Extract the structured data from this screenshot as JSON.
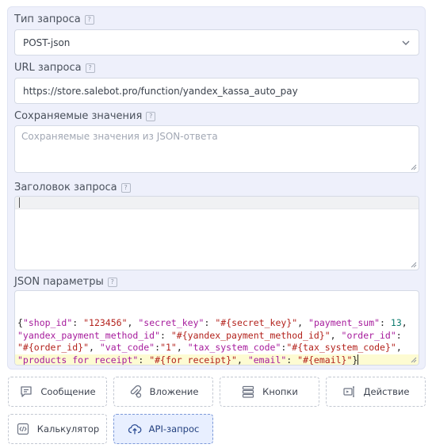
{
  "form": {
    "request_type": {
      "label": "Тип запроса",
      "help": "?",
      "value": "POST-json"
    },
    "url": {
      "label": "URL запроса",
      "help": "?",
      "value": "https://store.salebot.pro/function/yandex_kassa_auto_pay"
    },
    "saved_values": {
      "label": "Сохраняемые значения",
      "help": "?",
      "placeholder": "Сохраняемые значения из JSON-ответа"
    },
    "request_header": {
      "label": "Заголовок запроса",
      "help": "?",
      "value": ""
    },
    "json_params": {
      "label": "JSON параметры",
      "help": "?",
      "value": "{\"shop_id\": \"123456\", \"secret_key\": \"#{secret_key}\", \"payment_sum\": 13,\n\"yandex_payment_method_id\": \"#{yandex_payment_method_id}\", \"order_id\":\n\"#{order_id}\", \"vat_code\":\"1\", \"tax_system_code\":\"#{tax_system_code}\",\n\"products_for_receipt\": \"#{for_receipt}\", \"email\": \"#{email}\"}",
      "lines": [
        [
          {
            "t": "p",
            "v": "{"
          },
          {
            "t": "k",
            "v": "\"shop_id\""
          },
          {
            "t": "p",
            "v": ": "
          },
          {
            "t": "s",
            "v": "\"123456\""
          },
          {
            "t": "p",
            "v": ", "
          },
          {
            "t": "k",
            "v": "\"secret_key\""
          },
          {
            "t": "p",
            "v": ": "
          },
          {
            "t": "s",
            "v": "\"#{secret_key}\""
          },
          {
            "t": "p",
            "v": ", "
          },
          {
            "t": "k",
            "v": "\"payment_sum\""
          },
          {
            "t": "p",
            "v": ": "
          },
          {
            "t": "n",
            "v": "13"
          },
          {
            "t": "p",
            "v": ","
          }
        ],
        [
          {
            "t": "k",
            "v": "\"yandex_payment_method_id\""
          },
          {
            "t": "p",
            "v": ": "
          },
          {
            "t": "s",
            "v": "\"#{yandex_payment_method_id}\""
          },
          {
            "t": "p",
            "v": ", "
          },
          {
            "t": "k",
            "v": "\"order_id\""
          },
          {
            "t": "p",
            "v": ":"
          }
        ],
        [
          {
            "t": "s",
            "v": "\"#{order_id}\""
          },
          {
            "t": "p",
            "v": ", "
          },
          {
            "t": "k",
            "v": "\"vat_code\""
          },
          {
            "t": "p",
            "v": ":"
          },
          {
            "t": "s",
            "v": "\"1\""
          },
          {
            "t": "p",
            "v": ", "
          },
          {
            "t": "k",
            "v": "\"tax_system_code\""
          },
          {
            "t": "p",
            "v": ":"
          },
          {
            "t": "s",
            "v": "\"#{tax_system_code}\""
          },
          {
            "t": "p",
            "v": ","
          }
        ],
        [
          {
            "t": "k",
            "v": "\"products_for_receipt\""
          },
          {
            "t": "p",
            "v": ": "
          },
          {
            "t": "s",
            "v": "\"#{for_receipt}\""
          },
          {
            "t": "p",
            "v": ", "
          },
          {
            "t": "k",
            "v": "\"email\""
          },
          {
            "t": "p",
            "v": ": "
          },
          {
            "t": "s",
            "v": "\"#{email}\""
          },
          {
            "t": "p",
            "v": "}"
          }
        ]
      ]
    }
  },
  "blocks": [
    {
      "label": "Сообщение",
      "icon": "message-icon"
    },
    {
      "label": "Вложение",
      "icon": "attachment-icon"
    },
    {
      "label": "Кнопки",
      "icon": "buttons-icon"
    },
    {
      "label": "Действие",
      "icon": "action-icon"
    },
    {
      "label": "Калькулятор",
      "icon": "code-icon"
    },
    {
      "label": "API-запрос",
      "icon": "cloud-upload-icon",
      "active": true
    }
  ],
  "colors": {
    "panel_bg": "#eef0fb",
    "active_button_bg": "#e8efff",
    "json_key": "#a61b9c",
    "json_string": "#b3221c",
    "json_number": "#0c7b6e",
    "highlight_line": "#fdfbd2"
  }
}
